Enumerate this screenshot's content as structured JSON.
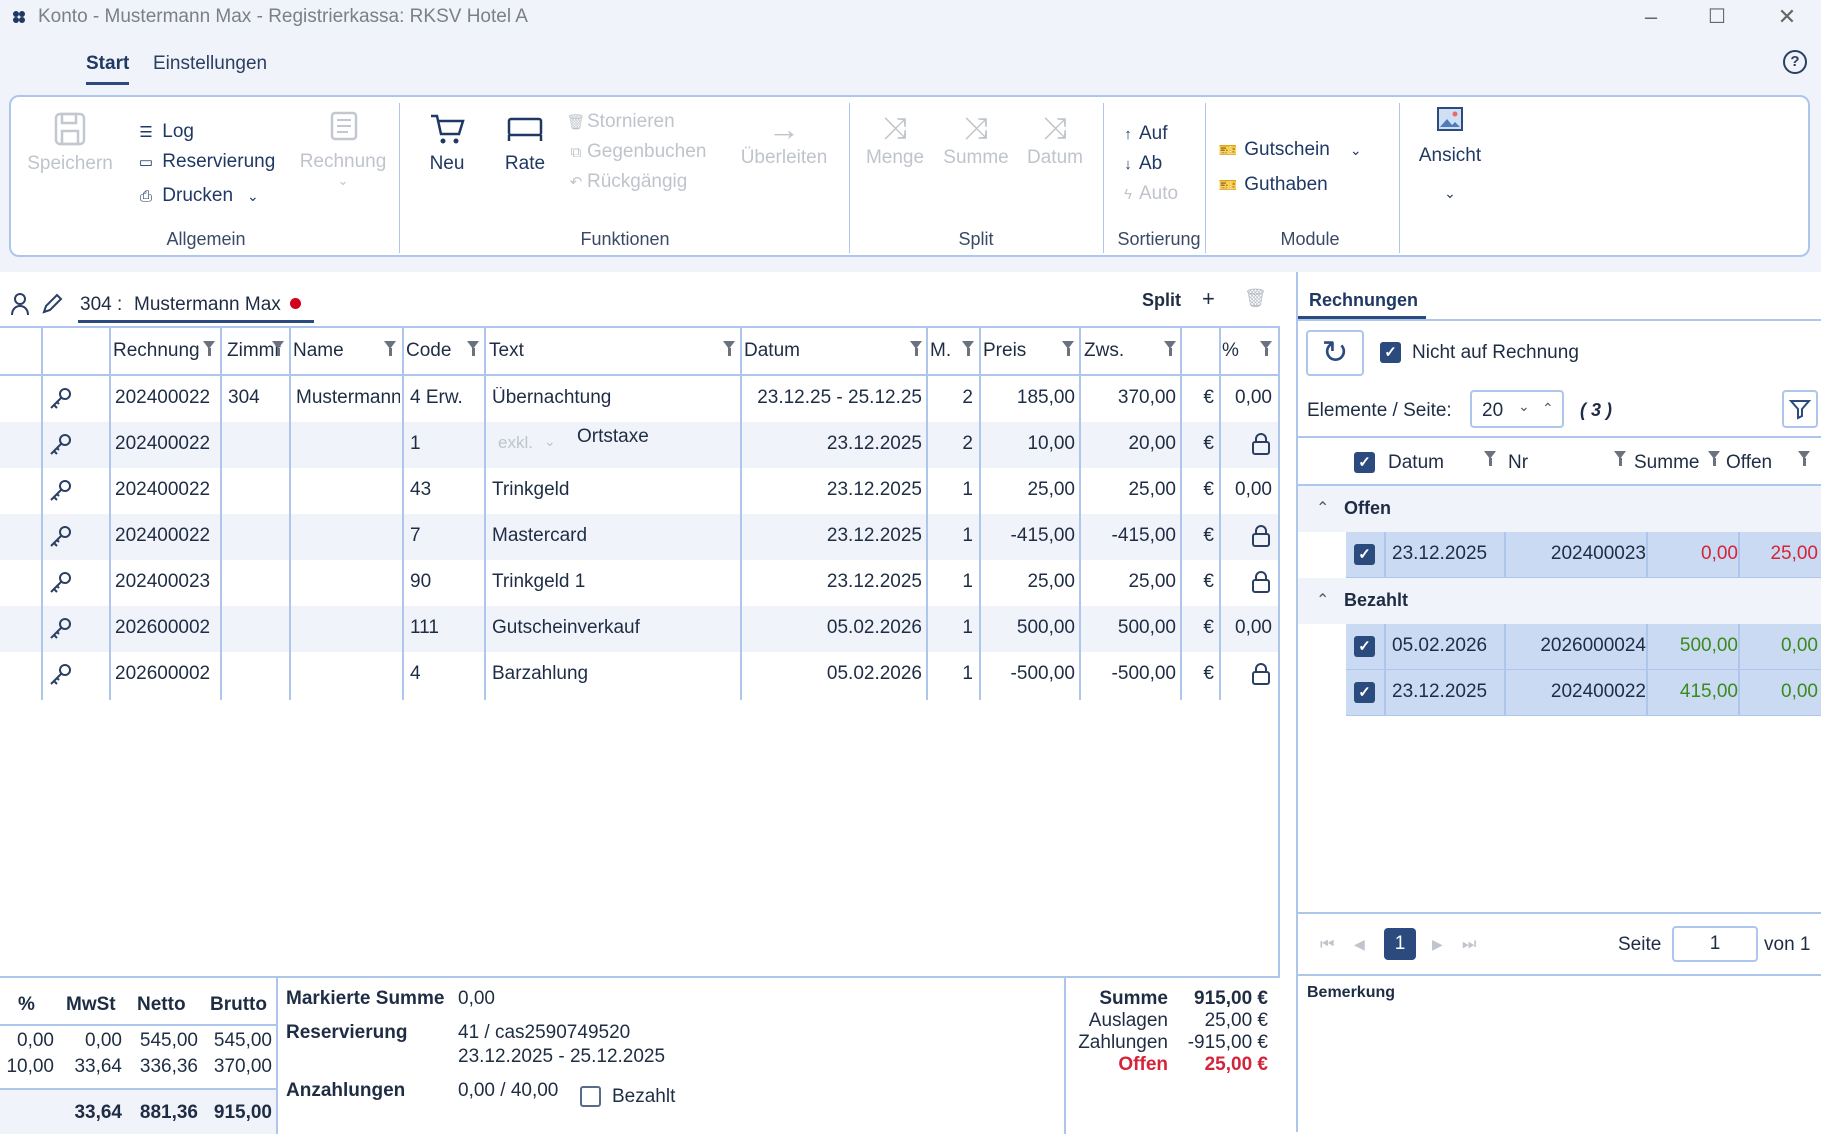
{
  "window": {
    "title": "Konto - Mustermann Max - Registrierkassa: RKSV Hotel A"
  },
  "menu": {
    "tabs": [
      "Start",
      "Einstellungen"
    ],
    "active": "Start",
    "help": "?"
  },
  "ribbon": {
    "allgemein": {
      "group": "Allgemein",
      "save": "Speichern",
      "log": "Log",
      "reservation": "Reservierung",
      "print": "Drucken",
      "invoice": "Rechnung"
    },
    "funktionen": {
      "group": "Funktionen",
      "new": "Neu",
      "rate": "Rate",
      "cancel": "Stornieren",
      "rebook": "Gegenbuchen",
      "undo": "Rückgängig",
      "transfer": "Überleiten"
    },
    "split": {
      "group": "Split",
      "quantity": "Menge",
      "sum": "Summe",
      "date": "Datum"
    },
    "sortierung": {
      "group": "Sortierung",
      "up": "Auf",
      "down": "Ab",
      "auto": "Auto"
    },
    "module": {
      "group": "Module",
      "voucher": "Gutschein",
      "credit": "Guthaben"
    },
    "view": {
      "label": "Ansicht"
    }
  },
  "customer": {
    "room": "304 :",
    "name": "Mustermann Max",
    "split": "Split",
    "add": "+"
  },
  "grid": {
    "headers": {
      "rechnung": "Rechnung",
      "zimmer": "Zimmr",
      "name": "Name",
      "code": "Code",
      "text": "Text",
      "datum": "Datum",
      "m": "M.",
      "preis": "Preis",
      "zws": "Zws.",
      "pct": "%"
    },
    "rows": [
      {
        "rechnung": "202400022",
        "zimmer": "304",
        "name": "Mustermann",
        "code": "4 Erw.",
        "text": "Übernachtung",
        "sub": "",
        "datum": "23.12.25 - 25.12.25",
        "m": "2",
        "preis": "185,00",
        "zws": "370,00",
        "cur": "€",
        "pct": "0,00",
        "lock": false
      },
      {
        "rechnung": "202400022",
        "zimmer": "",
        "name": "",
        "code": "1",
        "text": "Ortstaxe",
        "sub": "exkl.",
        "datum": "23.12.2025",
        "m": "2",
        "preis": "10,00",
        "zws": "20,00",
        "cur": "€",
        "pct": "",
        "lock": true
      },
      {
        "rechnung": "202400022",
        "zimmer": "",
        "name": "",
        "code": "43",
        "text": "Trinkgeld",
        "sub": "",
        "datum": "23.12.2025",
        "m": "1",
        "preis": "25,00",
        "zws": "25,00",
        "cur": "€",
        "pct": "0,00",
        "lock": false
      },
      {
        "rechnung": "202400022",
        "zimmer": "",
        "name": "",
        "code": "7",
        "text": "Mastercard",
        "sub": "",
        "datum": "23.12.2025",
        "m": "1",
        "preis": "-415,00",
        "zws": "-415,00",
        "cur": "€",
        "pct": "",
        "lock": true
      },
      {
        "rechnung": "202400023",
        "zimmer": "",
        "name": "",
        "code": "90",
        "text": "Trinkgeld 1",
        "sub": "",
        "datum": "23.12.2025",
        "m": "1",
        "preis": "25,00",
        "zws": "25,00",
        "cur": "€",
        "pct": "",
        "lock": true
      },
      {
        "rechnung": "202600002",
        "zimmer": "",
        "name": "",
        "code": "111",
        "text": "Gutscheinverkauf",
        "sub": "",
        "datum": "05.02.2026",
        "m": "1",
        "preis": "500,00",
        "zws": "500,00",
        "cur": "€",
        "pct": "0,00",
        "lock": false
      },
      {
        "rechnung": "202600002",
        "zimmer": "",
        "name": "",
        "code": "4",
        "text": "Barzahlung",
        "sub": "",
        "datum": "05.02.2026",
        "m": "1",
        "preis": "-500,00",
        "zws": "-500,00",
        "cur": "€",
        "pct": "",
        "lock": true
      }
    ]
  },
  "tax": {
    "headers": [
      "%",
      "MwSt",
      "Netto",
      "Brutto"
    ],
    "rows": [
      [
        "0,00",
        "0,00",
        "545,00",
        "545,00"
      ],
      [
        "10,00",
        "33,64",
        "336,36",
        "370,00"
      ]
    ],
    "total": [
      "",
      "33,64",
      "881,36",
      "915,00"
    ]
  },
  "info": {
    "marked_label": "Markierte Summe",
    "marked_value": "0,00",
    "reservation_label": "Reservierung",
    "reservation_value": "41 / cas2590749520",
    "reservation_dates": "23.12.2025  -  25.12.2025",
    "deposit_label": "Anzahlungen",
    "deposit_value": "0,00 / 40,00",
    "paid_label": "Bezahlt"
  },
  "totals": {
    "summe_label": "Summe",
    "summe": "915,00 €",
    "auslagen_label": "Auslagen",
    "auslagen": "25,00 €",
    "zahlungen_label": "Zahlungen",
    "zahlungen": "-915,00 €",
    "offen_label": "Offen",
    "offen": "25,00 €"
  },
  "invoices": {
    "tab": "Rechnungen",
    "not_on_invoice": "Nicht auf Rechnung",
    "per_page_label": "Elemente / Seite:",
    "per_page": "20",
    "count": "( 3 )",
    "headers": {
      "datum": "Datum",
      "nr": "Nr",
      "summe": "Summe",
      "offen": "Offen"
    },
    "groups": [
      {
        "label": "Offen",
        "rows": [
          {
            "datum": "23.12.2025",
            "nr": "202400023",
            "summe": "0,00",
            "offen": "25,00"
          }
        ]
      },
      {
        "label": "Bezahlt",
        "rows": [
          {
            "datum": "05.02.2026",
            "nr": "2026000024",
            "summe": "500,00",
            "offen": "0,00"
          },
          {
            "datum": "23.12.2025",
            "nr": "202400022",
            "summe": "415,00",
            "offen": "0,00"
          }
        ]
      }
    ],
    "pager": {
      "current": "1",
      "page_label": "Seite",
      "page_value": "1",
      "of_label": "von 1"
    },
    "remark": "Bemerkung"
  }
}
